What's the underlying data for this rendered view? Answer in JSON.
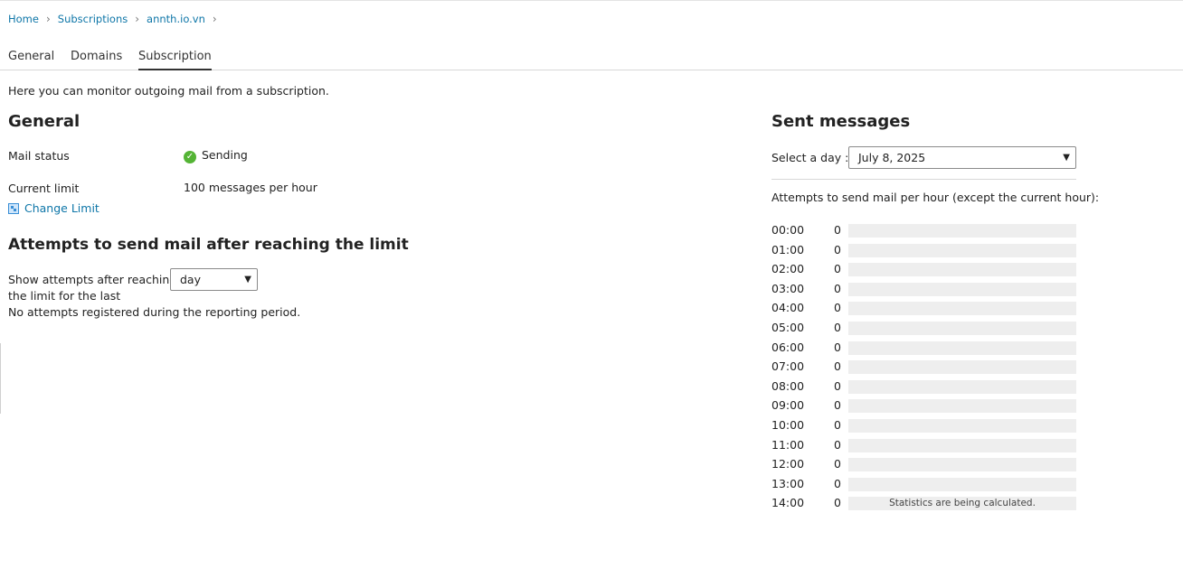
{
  "breadcrumb": [
    "Home",
    "Subscriptions",
    "annth.io.vn"
  ],
  "tabs": [
    "General",
    "Domains",
    "Subscription"
  ],
  "active_tab": "Subscription",
  "intro": "Here you can monitor outgoing mail from a subscription.",
  "general": {
    "title": "General",
    "mail_status_label": "Mail status",
    "mail_status_value": "Sending",
    "current_limit_label": "Current limit",
    "current_limit_value": "100 messages per hour",
    "change_limit_label": "Change Limit",
    "status_color": "#54b435"
  },
  "attempts": {
    "title": "Attempts to send mail after reaching the limit",
    "show_label_line1": "Show attempts after reaching",
    "show_label_line2": "the limit for the last",
    "period_selected": "day",
    "empty_text": "No attempts registered during the reporting period."
  },
  "sent": {
    "title": "Sent messages",
    "select_label": "Select a day :",
    "selected_day": "July 8, 2025",
    "chart_caption": "Attempts to send mail per hour (except the current hour):",
    "hours": [
      {
        "time": "00:00",
        "count": "0",
        "note": ""
      },
      {
        "time": "01:00",
        "count": "0",
        "note": ""
      },
      {
        "time": "02:00",
        "count": "0",
        "note": ""
      },
      {
        "time": "03:00",
        "count": "0",
        "note": ""
      },
      {
        "time": "04:00",
        "count": "0",
        "note": ""
      },
      {
        "time": "05:00",
        "count": "0",
        "note": ""
      },
      {
        "time": "06:00",
        "count": "0",
        "note": ""
      },
      {
        "time": "07:00",
        "count": "0",
        "note": ""
      },
      {
        "time": "08:00",
        "count": "0",
        "note": ""
      },
      {
        "time": "09:00",
        "count": "0",
        "note": ""
      },
      {
        "time": "10:00",
        "count": "0",
        "note": ""
      },
      {
        "time": "11:00",
        "count": "0",
        "note": ""
      },
      {
        "time": "12:00",
        "count": "0",
        "note": ""
      },
      {
        "time": "13:00",
        "count": "0",
        "note": ""
      },
      {
        "time": "14:00",
        "count": "0",
        "note": "Statistics are being calculated."
      }
    ]
  },
  "colors": {
    "link": "#0e76a8",
    "bar_track": "#eeeeee"
  }
}
